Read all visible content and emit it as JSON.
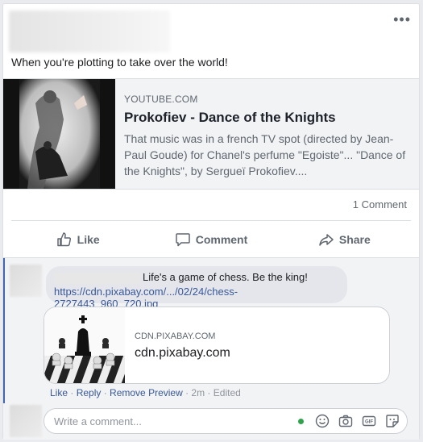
{
  "post": {
    "text": "When you're plotting to take over the world!",
    "more_icon": "more-icon"
  },
  "link_preview": {
    "domain": "YOUTUBE.COM",
    "title": "Prokofiev - Dance of the Knights",
    "description": "That music was in a french TV spot (directed by Jean-Paul Goude) for Chanel's perfume \"Egoiste\"... \"Dance of the Knights\", by Sergueï Prokofiev...."
  },
  "stats": {
    "comment_count": "1 Comment"
  },
  "actions": {
    "like": "Like",
    "comment": "Comment",
    "share": "Share"
  },
  "comment": {
    "text": "Life's a game of chess. Be the king!",
    "link": "https://cdn.pixabay.com/.../02/24/chess-2727443_960_720.jpg",
    "preview_domain": "CDN.PIXABAY.COM",
    "preview_title": "cdn.pixabay.com",
    "like": "Like",
    "reply": "Reply",
    "remove_preview": "Remove Preview",
    "time": "2m",
    "edited": "Edited"
  },
  "composer": {
    "placeholder": "Write a comment...",
    "icons": [
      "emoji-icon",
      "camera-icon",
      "gif-icon",
      "sticker-icon"
    ]
  },
  "colors": {
    "link": "#385898",
    "thread": "#4267b2",
    "online": "#31a24c"
  }
}
